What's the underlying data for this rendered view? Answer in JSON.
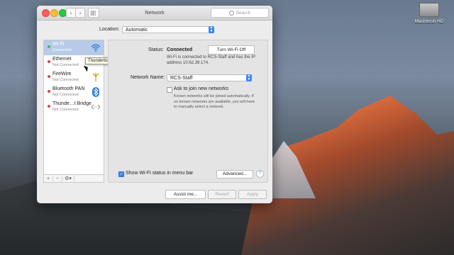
{
  "desktop": {
    "hd_label": "Macintosh HD"
  },
  "window": {
    "title": "Network",
    "search_placeholder": "Search"
  },
  "location": {
    "label": "Location:",
    "value": "Automatic"
  },
  "services": [
    {
      "name": "Wi-Fi",
      "status": "Connected",
      "icon": "wifi-icon",
      "dot_color": "#3fbd4a",
      "selected": true
    },
    {
      "name": "Ethernet",
      "status": "Not Connected",
      "icon": "ethernet-icon",
      "dot_color": "#e0443b"
    },
    {
      "name": "FireWire",
      "status": "Not Connected",
      "icon": "firewire-icon",
      "dot_color": "#e0443b"
    },
    {
      "name": "Bluetooth PAN",
      "status": "Not Connected",
      "icon": "bluetooth-icon",
      "dot_color": "#e0443b"
    },
    {
      "name": "Thunde…t Bridge",
      "status": "Not Connected",
      "icon": "thunderbolt-bridge-icon",
      "dot_color": "#e0443b"
    }
  ],
  "tooltip": "Thunderbolt Bridge",
  "sidebar_tools": {
    "add": "+",
    "remove": "−",
    "gear": "⚙︎▾"
  },
  "detail": {
    "status_label": "Status:",
    "status_value": "Connected",
    "turn_off_button": "Turn Wi-Fi Off",
    "status_description": "Wi-Fi is connected to RCS-Staff and has the IP address 10.62.39.174.",
    "network_name_label": "Network Name:",
    "network_name_value": "RCS-Staff",
    "ask_join_label": "Ask to join new networks",
    "ask_join_description": "Known networks will be joined automatically. If no known networks are available, you will have to manually select a network.",
    "show_menu_bar_label": "Show Wi-Fi status in menu bar",
    "advanced_button": "Advanced...",
    "help_button": "?"
  },
  "footer": {
    "assist_button": "Assist me...",
    "revert_button": "Revert",
    "apply_button": "Apply"
  }
}
